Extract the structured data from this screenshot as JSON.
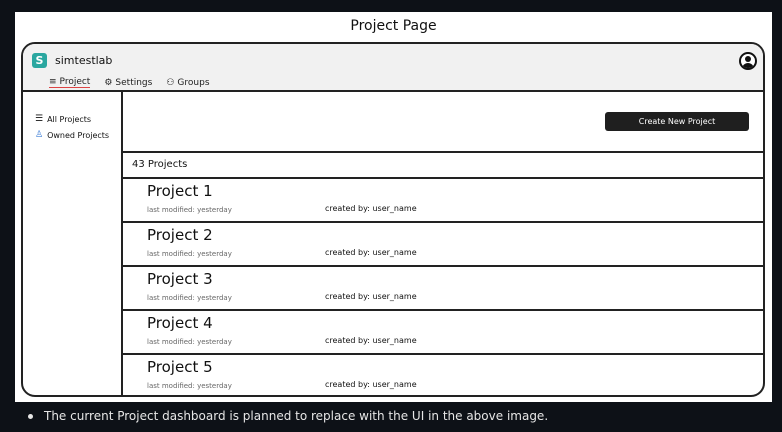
{
  "page_title": "Project Page",
  "app": {
    "name": "simtestlab",
    "logo_icon": "simtestlab-logo-icon",
    "brand_color": "#2aa7a0"
  },
  "nav": [
    {
      "label": "Project",
      "icon": "stack-icon",
      "active": true
    },
    {
      "label": "Settings",
      "icon": "gear-icon",
      "active": false
    },
    {
      "label": "Groups",
      "icon": "group-icon",
      "active": false
    }
  ],
  "user_avatar_icon": "user-avatar-icon",
  "sidebar": [
    {
      "label": "All Projects",
      "icon": "database-icon"
    },
    {
      "label": "Owned Projects",
      "icon": "user-icon"
    }
  ],
  "create_button": "Create New Project",
  "project_count": "43 Projects",
  "projects": [
    {
      "name": "Project 1",
      "modified": "last modified: yesterday",
      "created_by": "created by: user_name"
    },
    {
      "name": "Project 2",
      "modified": "last modified: yesterday",
      "created_by": "created by: user_name"
    },
    {
      "name": "Project 3",
      "modified": "last modified: yesterday",
      "created_by": "created by: user_name"
    },
    {
      "name": "Project 4",
      "modified": "last modified: yesterday",
      "created_by": "created by: user_name"
    },
    {
      "name": "Project 5",
      "modified": "last modified: yesterday",
      "created_by": "created by: user_name"
    }
  ],
  "caption": "The current Project dashboard is planned to replace with the UI in the above image."
}
